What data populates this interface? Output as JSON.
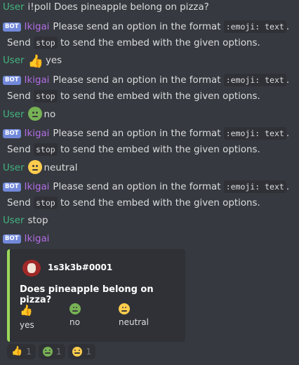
{
  "messages": [
    {
      "author": "User",
      "text": "i!poll Does pineapple belong on pizza?"
    },
    {
      "bot_tag": "BOT",
      "author": "Ikigai",
      "pre": "Please send an option in the format",
      "code1": ":emoji: text",
      "cont_pre": "Send",
      "code2": "stop",
      "cont_post": "to send the embed with the given options."
    },
    {
      "author": "User",
      "text": "yes"
    },
    {
      "bot_tag": "BOT",
      "author": "Ikigai",
      "pre": "Please send an option in the format",
      "code1": ":emoji: text",
      "cont_pre": "Send",
      "code2": "stop",
      "cont_post": "to send the embed with the given options."
    },
    {
      "author": "User",
      "text": "no"
    },
    {
      "bot_tag": "BOT",
      "author": "Ikigai",
      "pre": "Please send an option in the format",
      "code1": ":emoji: text",
      "cont_pre": "Send",
      "code2": "stop",
      "cont_post": "to send the embed with the given options."
    },
    {
      "author": "User",
      "text": "neutral"
    },
    {
      "bot_tag": "BOT",
      "author": "Ikigai",
      "pre": "Please send an option in the format",
      "code1": ":emoji: text",
      "cont_pre": "Send",
      "code2": "stop",
      "cont_post": "to send the embed with the given options."
    },
    {
      "author": "User",
      "text": "stop"
    },
    {
      "bot_tag": "BOT",
      "author": "Ikigai"
    }
  ],
  "embed": {
    "author": "1s3k3b#0001",
    "title": "Does pineapple belong on pizza?",
    "accent": "#9ad85a",
    "options": [
      {
        "icon": "thumbs-up",
        "label": "yes"
      },
      {
        "icon": "nauseated-face",
        "label": "no"
      },
      {
        "icon": "neutral-face",
        "label": "neutral"
      }
    ]
  },
  "reactions": [
    {
      "icon": "thumbs-up",
      "count": "1"
    },
    {
      "icon": "nauseated-face",
      "count": "1"
    },
    {
      "icon": "neutral-face",
      "count": "1"
    }
  ],
  "colors": {
    "background": "#36393f",
    "user": "#43b581",
    "bot": "#b46ee8",
    "bot_tag": "#7289da"
  }
}
